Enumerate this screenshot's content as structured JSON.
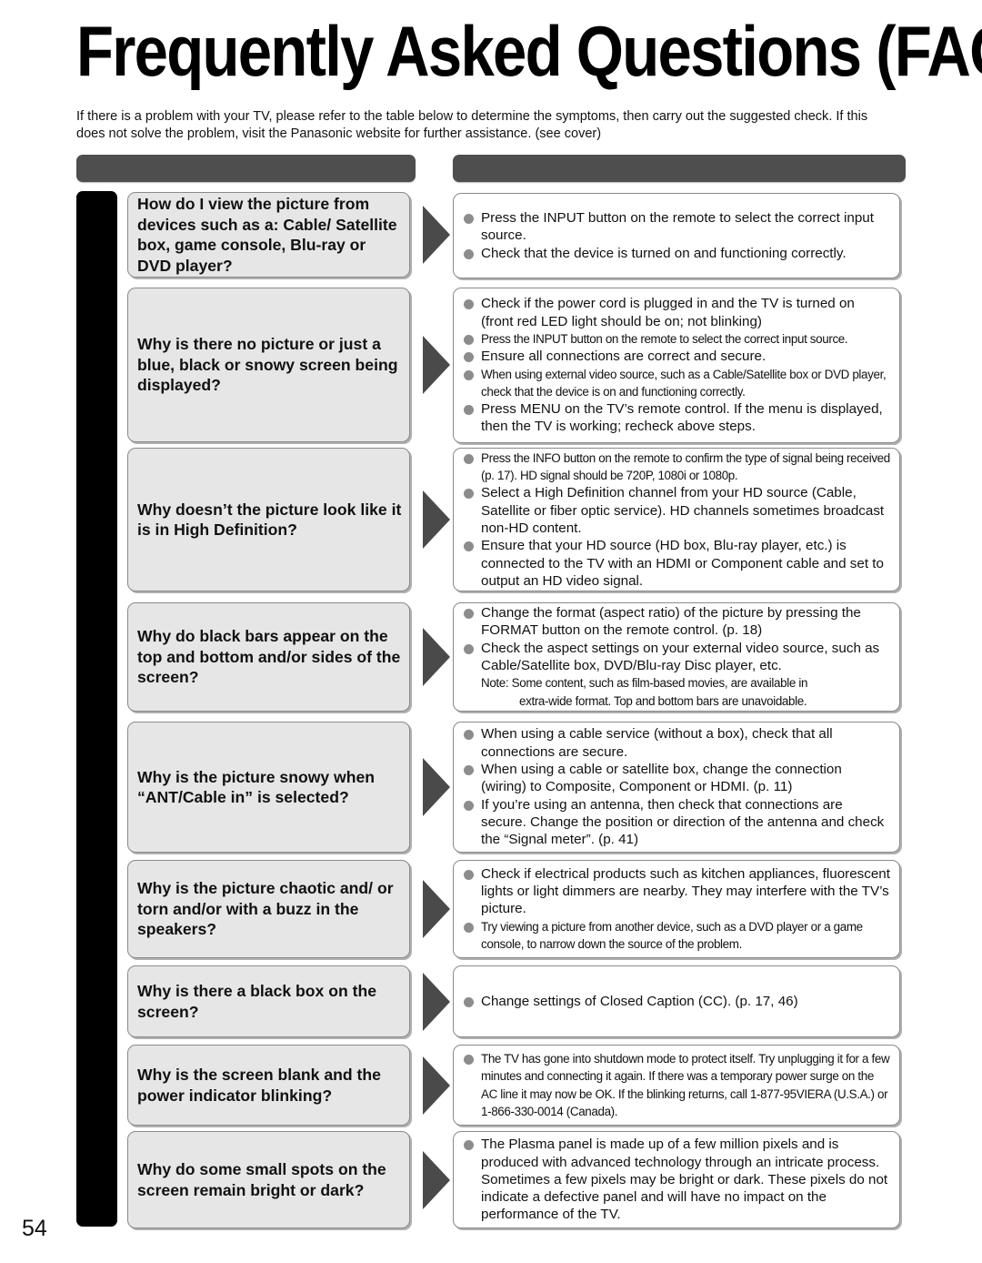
{
  "page": {
    "title": "Frequently Asked Questions (FAQ)",
    "intro": "If there is a problem with your TV, please refer to the table below to determine the symptoms, then carry out the suggested check. If this does not solve the problem, visit the Panasonic website for further assistance. (see cover)",
    "page_number": "54",
    "header_left": "",
    "header_right": ""
  },
  "faq": [
    {
      "question": "How do I view the picture from devices such as a: Cable/ Satellite box,  game console, Blu-ray or DVD player?",
      "answers": [
        {
          "text": "Press the INPUT button on the remote to select the correct input source.",
          "style": "normal"
        },
        {
          "text": "Check that the device is turned on and functioning correctly.",
          "style": "normal"
        }
      ]
    },
    {
      "question": "Why is there no picture or just a blue, black or snowy screen being displayed?",
      "answers": [
        {
          "text": "Check if the power cord is plugged in and the TV is turned on (front red LED light should be on; not blinking)",
          "style": "normal"
        },
        {
          "text": "Press the INPUT button on the remote to select the correct input source.",
          "style": "small"
        },
        {
          "text": "Ensure all connections are correct and secure.",
          "style": "normal"
        },
        {
          "text": "When using external video source, such as a Cable/Satellite box or DVD player, check that the device is on and functioning correctly.",
          "style": "small"
        },
        {
          "text": "Press MENU on the TV’s remote control. If the menu is displayed, then the TV is working; recheck above steps.",
          "style": "normal"
        }
      ]
    },
    {
      "question": "Why doesn’t the picture look like it is in High Definition?",
      "answers": [
        {
          "text": "Press the INFO button on the remote to confirm the type of signal being received (p. 17). HD signal should be 720P, 1080i or 1080p.",
          "style": "small"
        },
        {
          "text": "Select a High Definition channel from your HD source (Cable, Satellite or fiber optic service). HD channels sometimes broadcast non-HD content.",
          "style": "normal"
        },
        {
          "text": "Ensure that your HD source (HD box, Blu-ray player, etc.) is connected to the TV with an HDMI or Component cable and set to output an HD video signal.",
          "style": "normal"
        }
      ]
    },
    {
      "question": "Why do black bars appear on the top and bottom and/or sides of the screen?",
      "answers": [
        {
          "text": "Change the format (aspect ratio) of the picture by pressing the FORMAT button on the remote control. (p. 18)",
          "style": "normal"
        },
        {
          "text": "Check the aspect settings on your external video source, such as Cable/Satellite box, DVD/Blu-ray Disc player, etc.",
          "style": "normal"
        }
      ],
      "note": {
        "label": "Note:",
        "line1": "Some content, such as film-based movies, are available in",
        "line2": "extra-wide format. Top and bottom bars are unavoidable."
      }
    },
    {
      "question": "Why is the picture snowy when “ANT/Cable in” is selected?",
      "answers": [
        {
          "text": "When using a cable service (without a box), check that all connections are secure.",
          "style": "normal"
        },
        {
          "text": "When using a cable or satellite box, change the connection (wiring) to Composite, Component or HDMI. (p. 11)",
          "style": "normal"
        },
        {
          "text": "If you’re using an antenna, then check that connections are secure. Change the position or direction of the antenna and check the “Signal meter”. (p. 41)",
          "style": "normal"
        }
      ]
    },
    {
      "question": "Why is the picture chaotic and/ or torn and/or with a buzz in the speakers?",
      "answers": [
        {
          "text": "Check if electrical products such as kitchen appliances, fluorescent lights or light dimmers are nearby. They may interfere with the TV’s picture.",
          "style": "normal"
        },
        {
          "text": "Try viewing a picture from another device, such as a DVD player or a game console, to narrow down the source of the problem.",
          "style": "small"
        }
      ]
    },
    {
      "question": "Why is there a black box on the screen?",
      "answers": [
        {
          "text": "Change settings of Closed Caption (CC). (p. 17, 46)",
          "style": "normal"
        }
      ]
    },
    {
      "question": "Why is the screen blank and the power indicator blinking?",
      "answers": [
        {
          "text": "The TV has gone into shutdown mode to protect itself. Try unplugging it for a few minutes and connecting it again. If there was a temporary power surge on the AC line it may now be OK. If the blinking returns, call 1-877-95VIERA (U.S.A.) or 1-866-330-0014 (Canada).",
          "style": "small"
        }
      ]
    },
    {
      "question": "Why do some small spots on the screen remain bright or dark?",
      "answers": [
        {
          "text": "The Plasma panel is made up of a few million pixels and is produced with advanced technology through an intricate process. Sometimes a few pixels may be bright or dark. These pixels do not indicate a defective panel and will have no impact on the performance of the TV.",
          "style": "normal"
        }
      ]
    }
  ]
}
